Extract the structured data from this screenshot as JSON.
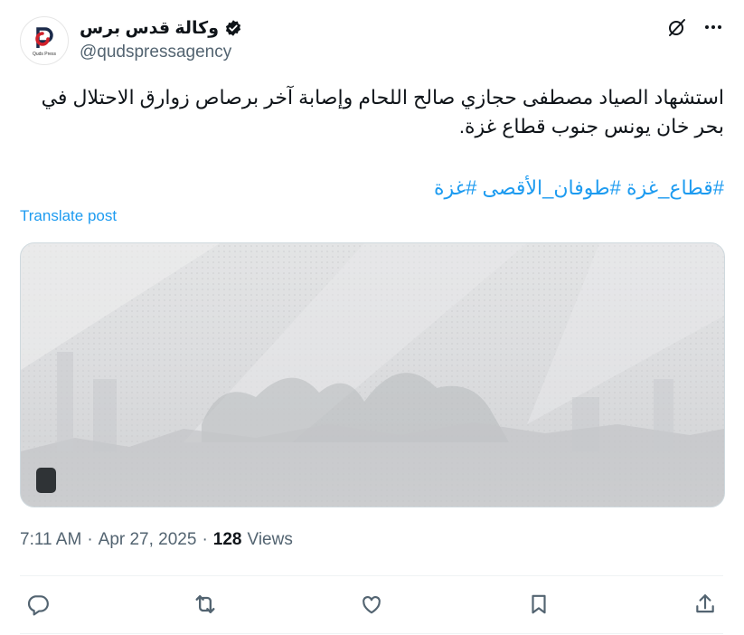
{
  "author": {
    "display_name": "وكالة قدس برس",
    "handle": "@qudspressagency",
    "avatar_icon": "quds-press-logo",
    "verified": true
  },
  "post": {
    "text": "استشهاد الصياد مصطفى حجازي صالح اللحام وإصابة آخر برصاص زوارق الاحتلال في بحر خان يونس جنوب قطاع غزة.",
    "hashtags": [
      "#قطاع_غزة",
      "#طوفان_الأقصى",
      "#غزة"
    ],
    "translate_label": "Translate post"
  },
  "media": {
    "type": "gif-preview",
    "badge_icon": "gif-badge-icon"
  },
  "meta": {
    "time": "7:11 AM",
    "separator": "·",
    "date": "Apr 27, 2025",
    "views_count": "128",
    "views_label": "Views"
  },
  "actions": [
    {
      "name": "reply",
      "icon": "reply-icon"
    },
    {
      "name": "repost",
      "icon": "repost-icon"
    },
    {
      "name": "like",
      "icon": "like-icon"
    },
    {
      "name": "bookmark",
      "icon": "bookmark-icon"
    },
    {
      "name": "share",
      "icon": "share-icon"
    }
  ],
  "colors": {
    "accent": "#1d9bf0",
    "text": "#0f1419",
    "secondary_text": "#536471",
    "border": "#cfd9de"
  }
}
